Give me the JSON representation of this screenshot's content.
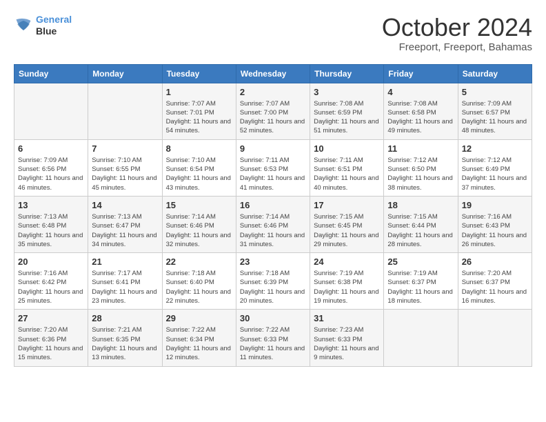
{
  "logo": {
    "line1": "General",
    "line2": "Blue"
  },
  "title": "October 2024",
  "location": "Freeport, Freeport, Bahamas",
  "days_of_week": [
    "Sunday",
    "Monday",
    "Tuesday",
    "Wednesday",
    "Thursday",
    "Friday",
    "Saturday"
  ],
  "weeks": [
    [
      {
        "day": "",
        "sunrise": "",
        "sunset": "",
        "daylight": ""
      },
      {
        "day": "",
        "sunrise": "",
        "sunset": "",
        "daylight": ""
      },
      {
        "day": "1",
        "sunrise": "Sunrise: 7:07 AM",
        "sunset": "Sunset: 7:01 PM",
        "daylight": "Daylight: 11 hours and 54 minutes."
      },
      {
        "day": "2",
        "sunrise": "Sunrise: 7:07 AM",
        "sunset": "Sunset: 7:00 PM",
        "daylight": "Daylight: 11 hours and 52 minutes."
      },
      {
        "day": "3",
        "sunrise": "Sunrise: 7:08 AM",
        "sunset": "Sunset: 6:59 PM",
        "daylight": "Daylight: 11 hours and 51 minutes."
      },
      {
        "day": "4",
        "sunrise": "Sunrise: 7:08 AM",
        "sunset": "Sunset: 6:58 PM",
        "daylight": "Daylight: 11 hours and 49 minutes."
      },
      {
        "day": "5",
        "sunrise": "Sunrise: 7:09 AM",
        "sunset": "Sunset: 6:57 PM",
        "daylight": "Daylight: 11 hours and 48 minutes."
      }
    ],
    [
      {
        "day": "6",
        "sunrise": "Sunrise: 7:09 AM",
        "sunset": "Sunset: 6:56 PM",
        "daylight": "Daylight: 11 hours and 46 minutes."
      },
      {
        "day": "7",
        "sunrise": "Sunrise: 7:10 AM",
        "sunset": "Sunset: 6:55 PM",
        "daylight": "Daylight: 11 hours and 45 minutes."
      },
      {
        "day": "8",
        "sunrise": "Sunrise: 7:10 AM",
        "sunset": "Sunset: 6:54 PM",
        "daylight": "Daylight: 11 hours and 43 minutes."
      },
      {
        "day": "9",
        "sunrise": "Sunrise: 7:11 AM",
        "sunset": "Sunset: 6:53 PM",
        "daylight": "Daylight: 11 hours and 41 minutes."
      },
      {
        "day": "10",
        "sunrise": "Sunrise: 7:11 AM",
        "sunset": "Sunset: 6:51 PM",
        "daylight": "Daylight: 11 hours and 40 minutes."
      },
      {
        "day": "11",
        "sunrise": "Sunrise: 7:12 AM",
        "sunset": "Sunset: 6:50 PM",
        "daylight": "Daylight: 11 hours and 38 minutes."
      },
      {
        "day": "12",
        "sunrise": "Sunrise: 7:12 AM",
        "sunset": "Sunset: 6:49 PM",
        "daylight": "Daylight: 11 hours and 37 minutes."
      }
    ],
    [
      {
        "day": "13",
        "sunrise": "Sunrise: 7:13 AM",
        "sunset": "Sunset: 6:48 PM",
        "daylight": "Daylight: 11 hours and 35 minutes."
      },
      {
        "day": "14",
        "sunrise": "Sunrise: 7:13 AM",
        "sunset": "Sunset: 6:47 PM",
        "daylight": "Daylight: 11 hours and 34 minutes."
      },
      {
        "day": "15",
        "sunrise": "Sunrise: 7:14 AM",
        "sunset": "Sunset: 6:46 PM",
        "daylight": "Daylight: 11 hours and 32 minutes."
      },
      {
        "day": "16",
        "sunrise": "Sunrise: 7:14 AM",
        "sunset": "Sunset: 6:46 PM",
        "daylight": "Daylight: 11 hours and 31 minutes."
      },
      {
        "day": "17",
        "sunrise": "Sunrise: 7:15 AM",
        "sunset": "Sunset: 6:45 PM",
        "daylight": "Daylight: 11 hours and 29 minutes."
      },
      {
        "day": "18",
        "sunrise": "Sunrise: 7:15 AM",
        "sunset": "Sunset: 6:44 PM",
        "daylight": "Daylight: 11 hours and 28 minutes."
      },
      {
        "day": "19",
        "sunrise": "Sunrise: 7:16 AM",
        "sunset": "Sunset: 6:43 PM",
        "daylight": "Daylight: 11 hours and 26 minutes."
      }
    ],
    [
      {
        "day": "20",
        "sunrise": "Sunrise: 7:16 AM",
        "sunset": "Sunset: 6:42 PM",
        "daylight": "Daylight: 11 hours and 25 minutes."
      },
      {
        "day": "21",
        "sunrise": "Sunrise: 7:17 AM",
        "sunset": "Sunset: 6:41 PM",
        "daylight": "Daylight: 11 hours and 23 minutes."
      },
      {
        "day": "22",
        "sunrise": "Sunrise: 7:18 AM",
        "sunset": "Sunset: 6:40 PM",
        "daylight": "Daylight: 11 hours and 22 minutes."
      },
      {
        "day": "23",
        "sunrise": "Sunrise: 7:18 AM",
        "sunset": "Sunset: 6:39 PM",
        "daylight": "Daylight: 11 hours and 20 minutes."
      },
      {
        "day": "24",
        "sunrise": "Sunrise: 7:19 AM",
        "sunset": "Sunset: 6:38 PM",
        "daylight": "Daylight: 11 hours and 19 minutes."
      },
      {
        "day": "25",
        "sunrise": "Sunrise: 7:19 AM",
        "sunset": "Sunset: 6:37 PM",
        "daylight": "Daylight: 11 hours and 18 minutes."
      },
      {
        "day": "26",
        "sunrise": "Sunrise: 7:20 AM",
        "sunset": "Sunset: 6:37 PM",
        "daylight": "Daylight: 11 hours and 16 minutes."
      }
    ],
    [
      {
        "day": "27",
        "sunrise": "Sunrise: 7:20 AM",
        "sunset": "Sunset: 6:36 PM",
        "daylight": "Daylight: 11 hours and 15 minutes."
      },
      {
        "day": "28",
        "sunrise": "Sunrise: 7:21 AM",
        "sunset": "Sunset: 6:35 PM",
        "daylight": "Daylight: 11 hours and 13 minutes."
      },
      {
        "day": "29",
        "sunrise": "Sunrise: 7:22 AM",
        "sunset": "Sunset: 6:34 PM",
        "daylight": "Daylight: 11 hours and 12 minutes."
      },
      {
        "day": "30",
        "sunrise": "Sunrise: 7:22 AM",
        "sunset": "Sunset: 6:33 PM",
        "daylight": "Daylight: 11 hours and 11 minutes."
      },
      {
        "day": "31",
        "sunrise": "Sunrise: 7:23 AM",
        "sunset": "Sunset: 6:33 PM",
        "daylight": "Daylight: 11 hours and 9 minutes."
      },
      {
        "day": "",
        "sunrise": "",
        "sunset": "",
        "daylight": ""
      },
      {
        "day": "",
        "sunrise": "",
        "sunset": "",
        "daylight": ""
      }
    ]
  ]
}
